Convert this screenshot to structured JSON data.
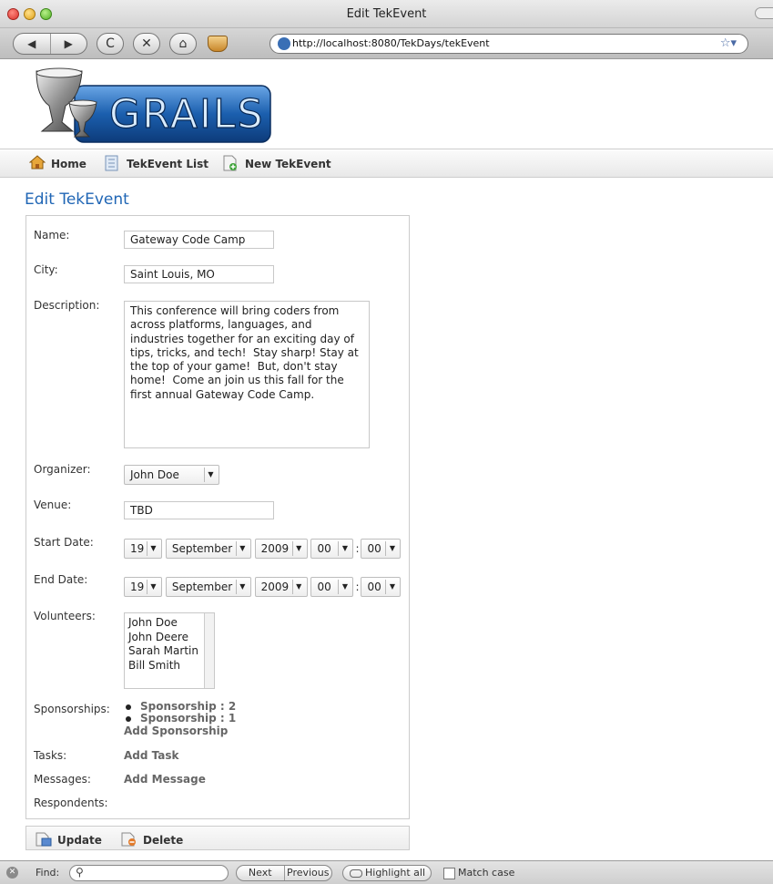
{
  "window": {
    "title": "Edit TekEvent"
  },
  "browser": {
    "back_label": "◀",
    "forward_label": "▶",
    "reload_label": "C",
    "stop_label": "✕",
    "home_label": "⌂",
    "url": "http://localhost:8080/TekDays/tekEvent"
  },
  "logo": {
    "text": "GRAILS"
  },
  "nav": {
    "home": "Home",
    "list": "TekEvent List",
    "new": "New TekEvent"
  },
  "page": {
    "title": "Edit TekEvent"
  },
  "form": {
    "name_label": "Name:",
    "name_value": "Gateway Code Camp",
    "city_label": "City:",
    "city_value": "Saint Louis, MO",
    "description_label": "Description:",
    "description_value": "This conference will bring coders from across platforms, languages, and industries together for an exciting day of tips, tricks, and tech!  Stay sharp! Stay at the top of your game!  But, don't stay home!  Come an join us this fall for the first annual Gateway Code Camp.",
    "organizer_label": "Organizer:",
    "organizer_value": "John Doe",
    "venue_label": "Venue:",
    "venue_value": "TBD",
    "start_label": "Start Date:",
    "start": {
      "day": "19",
      "month": "September",
      "year": "2009",
      "hour": "00",
      "minute": "00"
    },
    "end_label": "End Date:",
    "end": {
      "day": "19",
      "month": "September",
      "year": "2009",
      "hour": "00",
      "minute": "00"
    },
    "time_sep": ":",
    "volunteers_label": "Volunteers:",
    "volunteers": [
      "John Doe",
      "John Deere",
      "Sarah Martin",
      "Bill Smith"
    ],
    "sponsorships_label": "Sponsorships:",
    "sponsorships": [
      "Sponsorship : 2",
      "Sponsorship : 1"
    ],
    "add_sponsorship": "Add Sponsorship",
    "tasks_label": "Tasks:",
    "add_task": "Add Task",
    "messages_label": "Messages:",
    "add_message": "Add Message",
    "respondents_label": "Respondents:"
  },
  "actions": {
    "update": "Update",
    "delete": "Delete"
  },
  "findbar": {
    "label": "Find:",
    "query": "",
    "next": "Next",
    "previous": "Previous",
    "highlight_all": "Highlight all",
    "match_case": "Match case"
  }
}
